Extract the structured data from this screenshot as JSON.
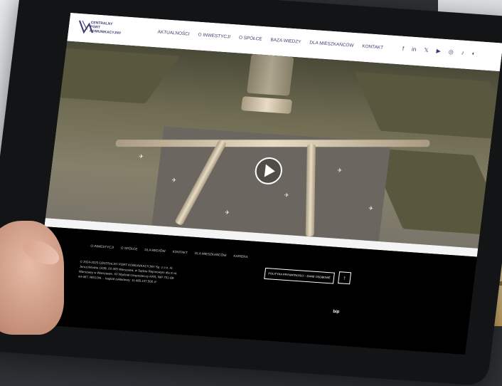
{
  "brand": {
    "line1": "CENTRALNY PORT",
    "line2": "KOMUNIKACYJNY"
  },
  "nav": {
    "items": [
      "AKTUALNOŚCI",
      "O INWESTYCJI",
      "O SPÓŁCE",
      "BAZA WIEDZY",
      "DLA MIESZKAŃCÓW",
      "KONTAKT"
    ],
    "social": [
      "f",
      "in",
      "𝕏",
      "▶",
      "◎",
      "♪",
      "◐"
    ]
  },
  "footer": {
    "links": [
      "O INWESTYCJI",
      "O SPÓŁCE",
      "DLA MEDIÓW",
      "KONTAKT",
      "DLA MIESZKAŃCÓW",
      "KARIERA"
    ],
    "address": "© 2024-2025 CENTRALNY PORT KOMUNIKACYJNY Sp. z o.o. Al. Jerozolimskie 142B, 02-305 Warszawa, w Sądzie Rejonowym dla m.st. Warszawy w Warszawie, XII Wydział Gospodarczy KRS, NIP 701-08-44-467, REGON ... kapitał zakładowy: 11.485.107.500 zł",
    "privacy_label": "POLITYKA PRYWATNOŚCI – DANE OSOBOWE",
    "up_label": "↑",
    "bip_label": "bip"
  },
  "colors": {
    "brand": "#3a3f73",
    "footer_bg": "#000000"
  }
}
